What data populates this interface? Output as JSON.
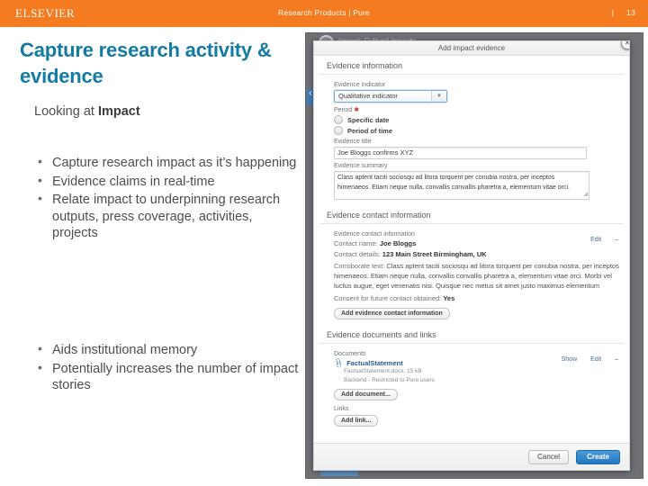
{
  "header": {
    "brand": "ELSEVIER",
    "center": "Research Products  |  Pure",
    "separator": "|",
    "page_number": "13",
    "bg_color": "#f47b20"
  },
  "slide": {
    "title": "Capture research activity & evidence",
    "subhead_prefix": "Looking at ",
    "subhead_bold": "Impact",
    "title_color": "#127ba3",
    "bullets_group_1": [
      "Capture research impact as it’s happening",
      "Evidence claims in real-time",
      "Relate impact to underpinning research outputs, press coverage, activities, projects"
    ],
    "bullets_group_2": [
      "Aids institutional memory",
      "Potentially increases the number of impact stories"
    ],
    "bullet_glyph": "•"
  },
  "screenshot": {
    "background_title": "Impact: Cultural impacts",
    "modal": {
      "title": "Add impact evidence",
      "close_glyph": "×",
      "sections": {
        "evidence_information": {
          "heading": "Evidence information",
          "indicator_label": "Evidence indicator",
          "indicator_value": "Qualitative indicator",
          "indicator_arrow": "▼",
          "period_label": "Period",
          "period_required": "✱",
          "period_options": [
            "Specific date",
            "Period of time"
          ],
          "title_label": "Evidence title",
          "title_value": "Joe Bloggs confirms XYZ",
          "summary_label": "Evidence summary",
          "summary_value": "Class aptent taciti sociosqu ad litora torquent per conubia nostra, per inceptos himenaeos. Etiam neque nulla, convallis convallis pharetra a, elementum vitae orci.",
          "resize_grip": "◢"
        },
        "evidence_contact": {
          "heading": "Evidence contact information",
          "subheading": "Evidence contact information",
          "contact_name_label": "Contact name:",
          "contact_name_value": "Joe Bloggs",
          "contact_details_label": "Contact details:",
          "contact_details_value": "123 Main Street Birmingham, UK",
          "corroborate_label": "Corroborate text:",
          "corroborate_value": "Class aptent taciti sociosqu ad litora torquent per conubia nostra, per inceptos himenaeos. Etiam neque nulla, convallis convallis pharetra a, elementum vitae orci. Morbi vel luctus augue, eget venenatis nisi. Quisque nec metus sit amet justo maximus elementum",
          "consent_label": "Consent for future contact obtained:",
          "consent_value": "Yes",
          "edit_link": "Edit",
          "remove_glyph": "–",
          "add_button": "Add evidence contact information"
        },
        "evidence_documents": {
          "heading": "Evidence documents and links",
          "documents_label": "Documents",
          "document_name": "FactualStatement",
          "document_meta": "FactualStatement.docx, 15 kB",
          "document_access": "Backend - Restricted to Pure users",
          "clip_glyph": "📎",
          "show_link": "Show",
          "edit_link": "Edit",
          "remove_glyph": "–",
          "add_document_button": "Add document...",
          "links_label": "Links",
          "add_link_button": "Add link..."
        }
      },
      "footer": {
        "cancel_label": "Cancel",
        "create_label": "Create",
        "create_color": "#2277bf"
      }
    }
  }
}
